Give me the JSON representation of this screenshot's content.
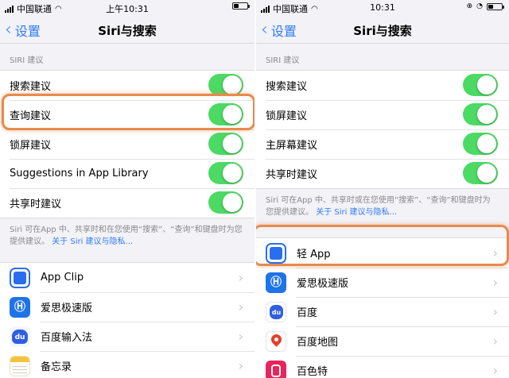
{
  "colors": {
    "accent": "#2f7bf5",
    "toggle_on": "#4cd964",
    "highlight": "#e88a4c"
  },
  "left": {
    "status": {
      "carrier": "中国联通",
      "time": "上午10:31"
    },
    "nav": {
      "back_label": "设置",
      "title": "Siri与搜索"
    },
    "section_header": "SIRI 建议",
    "settings": [
      {
        "label": "搜索建议",
        "on": true
      },
      {
        "label": "查询建议",
        "on": true
      },
      {
        "label": "锁屏建议",
        "on": true
      },
      {
        "label": "Suggestions in App Library",
        "on": true
      },
      {
        "label": "共享时建议",
        "on": true
      }
    ],
    "footer_text": "Siri 可在App 中、共享时和在您使用“搜索”、“查询”和键盘时为您提供建议。",
    "footer_link": "关于 Siri 建议与隐私...",
    "apps": [
      {
        "name": "App Clip",
        "icon": "app-clip-icon"
      },
      {
        "name": "爱思极速版",
        "icon": "aisi-icon"
      },
      {
        "name": "百度输入法",
        "icon": "baidu-input-icon"
      },
      {
        "name": "备忘录",
        "icon": "notes-icon"
      }
    ]
  },
  "right": {
    "status": {
      "carrier": "中国联通",
      "time": "10:31"
    },
    "nav": {
      "back_label": "设置",
      "title": "Siri与搜索"
    },
    "section_header": "SIRI 建议",
    "settings": [
      {
        "label": "搜索建议",
        "on": true
      },
      {
        "label": "锁屏建议",
        "on": true
      },
      {
        "label": "主屏幕建议",
        "on": true
      },
      {
        "label": "共享时建议",
        "on": true
      }
    ],
    "footer_text": "Siri 可在App 中、共享时或在您使用“搜索”、“查询”和键盘时为您提供建议。",
    "footer_link": "关于 Siri 建议与隐私...",
    "apps": [
      {
        "name": "轻 App",
        "icon": "app-clip-icon"
      },
      {
        "name": "爱思极速版",
        "icon": "aisi-icon"
      },
      {
        "name": "百度",
        "icon": "baidu-icon"
      },
      {
        "name": "百度地图",
        "icon": "baidu-map-icon"
      },
      {
        "name": "百色特",
        "icon": "baisete-icon"
      }
    ]
  }
}
